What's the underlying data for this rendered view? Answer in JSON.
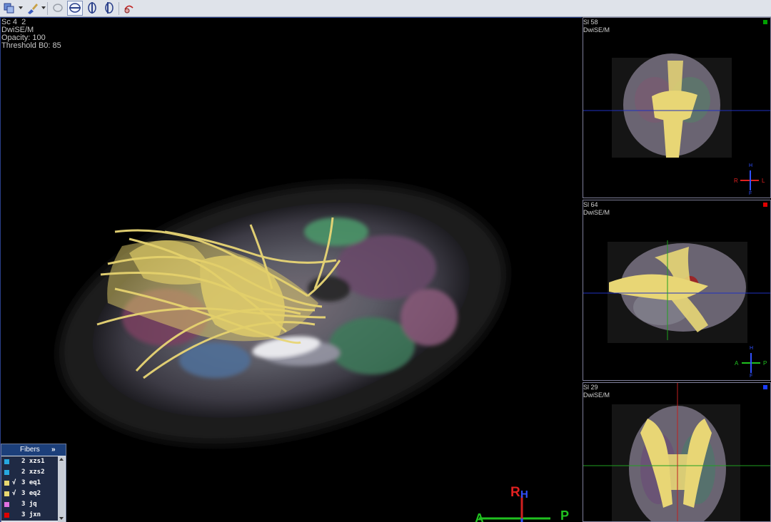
{
  "toolbar": {
    "buttons": [
      "layers-tool",
      "brush-tool",
      "lasso-tool",
      "axial-view",
      "coronal-view",
      "sagittal-view",
      "fiber-tool"
    ]
  },
  "main_view": {
    "line1": "Sc 4  2",
    "line2": "DwiSE/M",
    "line3": "Opacity: 100",
    "line4": "Threshold B0: 85",
    "orientation": {
      "top": "R",
      "top2": "H",
      "left": "A",
      "right": "P"
    }
  },
  "panels": [
    {
      "line1": "Sl 58",
      "line2": "DwiSE/M",
      "marker_color": "#00a000",
      "orientation": {
        "top": "H",
        "left": "R",
        "right": "L",
        "bottom": "F"
      }
    },
    {
      "line1": "Sl 64",
      "line2": "DwiSE/M",
      "marker_color": "#e00000",
      "orientation": {
        "top": "H",
        "left": "A",
        "right": "P",
        "bottom": "F"
      }
    },
    {
      "line1": "Sl 29",
      "line2": "DwiSE/M",
      "marker_color": "#1a3cff"
    }
  ],
  "fibers": {
    "title": "Fibers",
    "expand": "»",
    "items": [
      {
        "color": "#27a8e0",
        "checked": "",
        "name": "2 xzs1"
      },
      {
        "color": "#27a8e0",
        "checked": "",
        "name": "2 xzs2"
      },
      {
        "color": "#e8d870",
        "checked": "√",
        "name": "3 eq1"
      },
      {
        "color": "#e8d870",
        "checked": "√",
        "name": "3 eq2"
      },
      {
        "color": "#e070e0",
        "checked": "",
        "name": "3 jq"
      },
      {
        "color": "#e00000",
        "checked": "",
        "name": "3 jxn"
      }
    ]
  }
}
